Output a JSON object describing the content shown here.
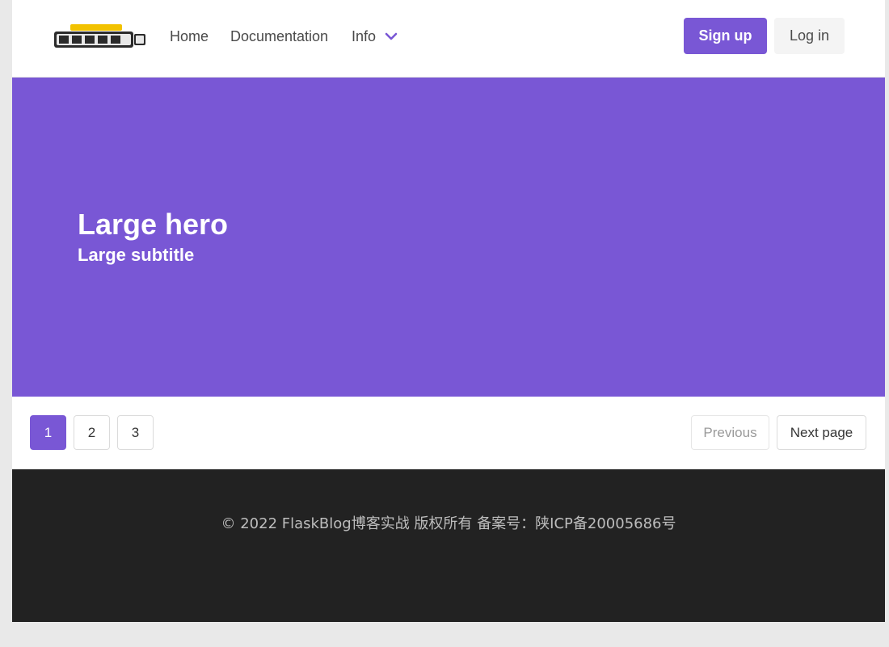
{
  "colors": {
    "primary": "#7957d5",
    "footer_bg": "#222222",
    "page_bg": "#e9e9e9"
  },
  "navbar": {
    "logo_icon": "brand-logo-icon",
    "items": [
      {
        "label": "Home"
      },
      {
        "label": "Documentation"
      },
      {
        "label": "Info",
        "icon": "chevron-down-icon"
      }
    ],
    "signup_label": "Sign up",
    "login_label": "Log in"
  },
  "hero": {
    "title": "Large hero",
    "subtitle": "Large subtitle"
  },
  "pagination": {
    "pages": [
      "1",
      "2",
      "3"
    ],
    "current_page": "1",
    "previous_label": "Previous",
    "next_label": "Next page"
  },
  "footer": {
    "copyright": "© 2022 FlaskBlog博客实战 版权所有 备案号：陕ICP备20005686号"
  }
}
